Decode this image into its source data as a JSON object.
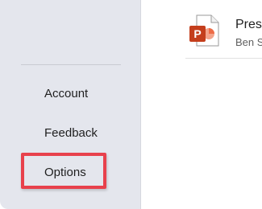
{
  "nav": {
    "items": [
      {
        "label": "Account"
      },
      {
        "label": "Feedback"
      },
      {
        "label": "Options"
      }
    ]
  },
  "recent": {
    "file_name": "Pres",
    "file_path": "Ben S",
    "icon": "powerpoint-file-icon",
    "icon_letter": "P"
  },
  "colors": {
    "nav_bg": "#e4e6ed",
    "highlight": "#e8414c",
    "ppt_orange": "#c43e1c"
  }
}
